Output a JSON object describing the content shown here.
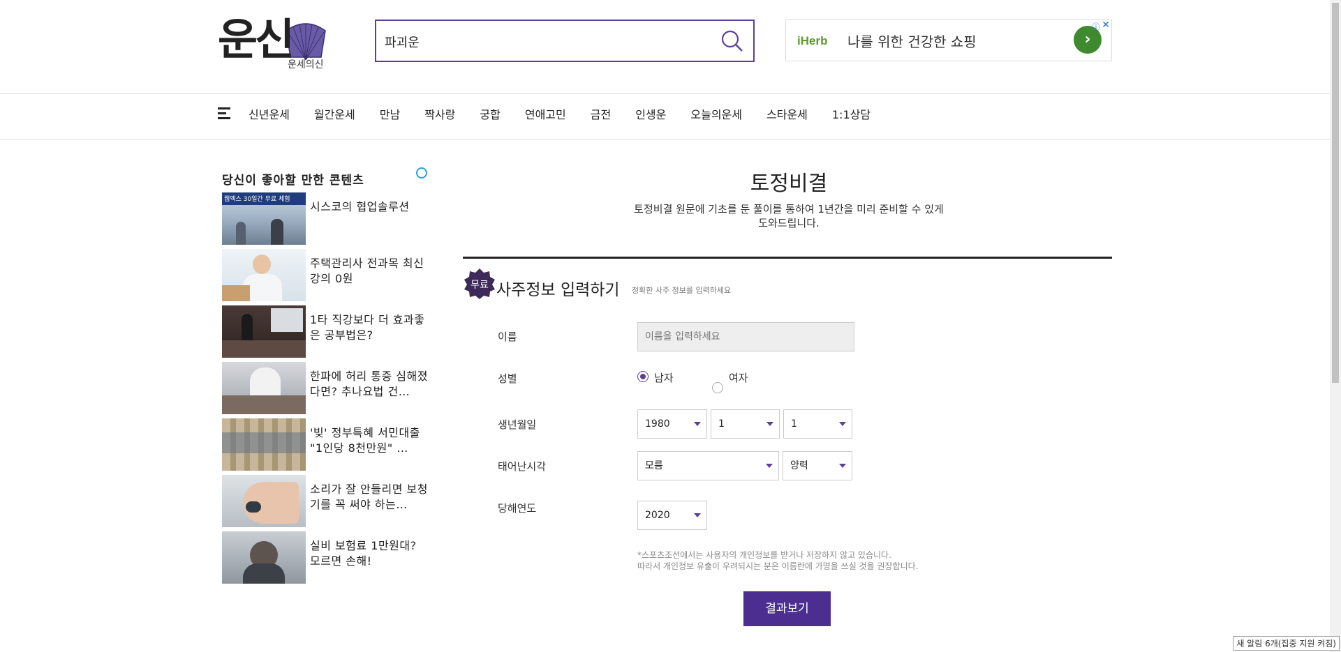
{
  "header": {
    "logo_main": "운신",
    "logo_sub": "운세의신",
    "search_value": "파괴운",
    "ad": {
      "brand": "iHerb",
      "text": "나를 위한 건강한 쇼핑",
      "go": "›",
      "info": "ⓘ",
      "close": "✕"
    }
  },
  "nav": {
    "items": [
      "신년운세",
      "월간운세",
      "만남",
      "짝사랑",
      "궁합",
      "연애고민",
      "금전",
      "인생운",
      "오늘의운세",
      "스타운세",
      "1:1상담"
    ]
  },
  "sidebar": {
    "title": "당신이 좋아할 만한 콘텐츠",
    "items": [
      {
        "text": "시스코의 협업솔루션",
        "thumb_caption": "웹엑스 30일간 무료 체험"
      },
      {
        "text": "주택관리사 전과목 최신강의 0원"
      },
      {
        "text": "1타 직강보다 더 효과좋은 공부법은?"
      },
      {
        "text": "한파에 허리 통증 심해졌다면? 추나요법 건…"
      },
      {
        "text": "'빚' 정부특혜 서민대출 \"1인당 8천만원\" …"
      },
      {
        "text": "소리가 잘 안들리면 보청기를 꼭 써야 하는…"
      },
      {
        "text": "실비 보험료 1만원대? 모르면 손해!"
      }
    ]
  },
  "main": {
    "title": "토정비결",
    "desc_line1": "토정비결 원문에 기초를 둔 풀이를 통하여 1년간을 미리 준비할 수 있게",
    "desc_line2": "도와드립니다.",
    "badge": "무료",
    "section_title": "사주정보 입력하기",
    "section_note": "정확한 사주 정보를 입력하세요",
    "form": {
      "name_label": "이름",
      "name_placeholder": "이름을 입력하세요",
      "gender_label": "성별",
      "gender_male": "남자",
      "gender_female": "여자",
      "birth_label": "생년월일",
      "birth_year": "1980",
      "birth_month": "1",
      "birth_day": "1",
      "time_label": "태어난시각",
      "time_value": "모름",
      "calendar_value": "양력",
      "year_label": "당해연도",
      "year_value": "2020"
    },
    "notice_line1": "*스포츠조선에서는 사용자의 개인정보를 받거나 저장하지 않고 있습니다.",
    "notice_line2": "따라서 개인정보 유출이 우려되시는 분은 이름란에 가명을 쓰실 것을 권장합니다.",
    "submit": "결과보기"
  },
  "status_bar": "새 알림 6개(집중 지원 켜짐)",
  "colors": {
    "accent": "#4b2e8f",
    "ad_green": "#3f8a2e"
  }
}
